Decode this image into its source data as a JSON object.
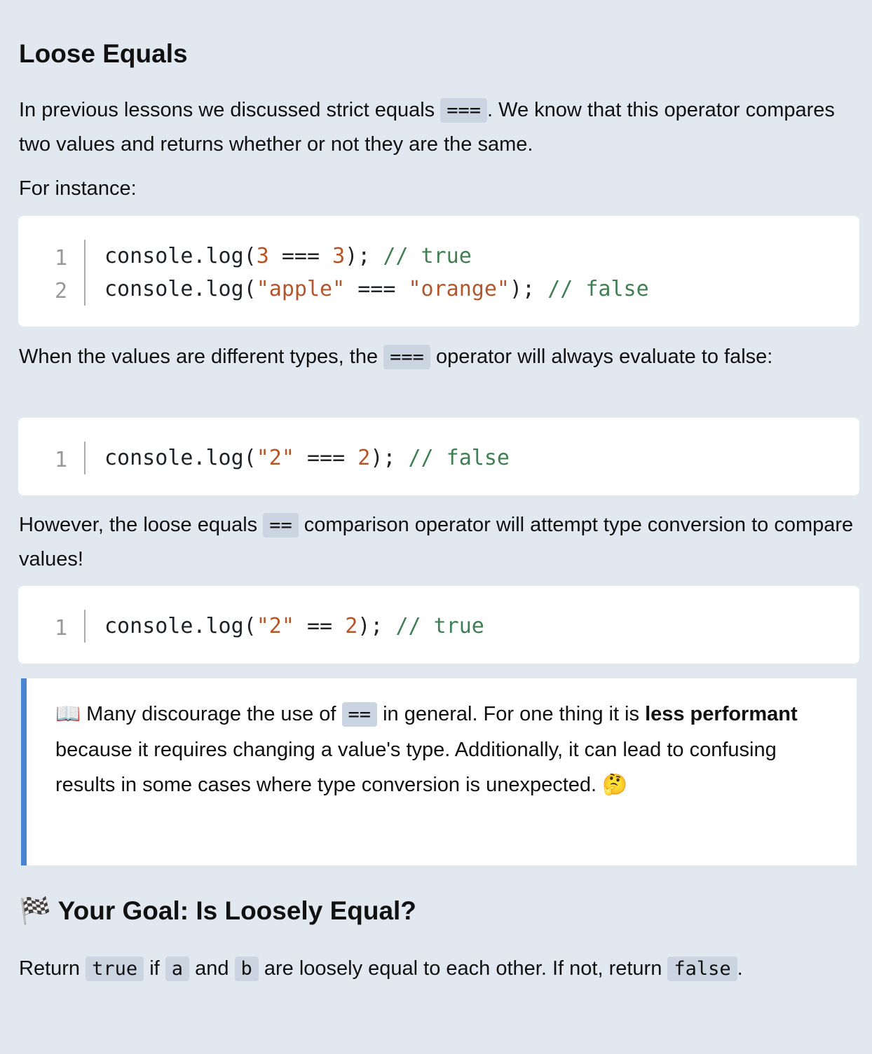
{
  "title": "Loose Equals",
  "para1": [
    {
      "text": "In previous lessons we discussed strict equals "
    },
    {
      "code": "==="
    },
    {
      "text": ". We know that this operator compares two values and returns whether or not they are the same."
    }
  ],
  "para2": [
    {
      "text": "For instance:"
    }
  ],
  "code1": [
    [
      {
        "t": "console.log(",
        "c": "plain"
      },
      {
        "t": "3",
        "c": "num"
      },
      {
        "t": " === ",
        "c": "plain"
      },
      {
        "t": "3",
        "c": "num"
      },
      {
        "t": "); ",
        "c": "plain"
      },
      {
        "t": "// true",
        "c": "com"
      }
    ],
    [
      {
        "t": "console.log(",
        "c": "plain"
      },
      {
        "t": "\"apple\"",
        "c": "str"
      },
      {
        "t": " === ",
        "c": "plain"
      },
      {
        "t": "\"orange\"",
        "c": "str"
      },
      {
        "t": "); ",
        "c": "plain"
      },
      {
        "t": "// false",
        "c": "com"
      }
    ]
  ],
  "para3": [
    {
      "text": "When the values are different types, the "
    },
    {
      "code": "==="
    },
    {
      "text": " operator will always evaluate to false:"
    }
  ],
  "code2": [
    [
      {
        "t": "console.log(",
        "c": "plain"
      },
      {
        "t": "\"2\"",
        "c": "str"
      },
      {
        "t": " === ",
        "c": "plain"
      },
      {
        "t": "2",
        "c": "num"
      },
      {
        "t": "); ",
        "c": "plain"
      },
      {
        "t": "// false",
        "c": "com"
      }
    ]
  ],
  "para4": [
    {
      "text": "However, the loose equals "
    },
    {
      "code": "=="
    },
    {
      "text": " comparison operator will attempt type conversion to compare values!"
    }
  ],
  "code3": [
    [
      {
        "t": "console.log(",
        "c": "plain"
      },
      {
        "t": "\"2\"",
        "c": "str"
      },
      {
        "t": " == ",
        "c": "plain"
      },
      {
        "t": "2",
        "c": "num"
      },
      {
        "t": "); ",
        "c": "plain"
      },
      {
        "t": "// true",
        "c": "com"
      }
    ]
  ],
  "callout": [
    {
      "text": "📖 Many discourage the use of "
    },
    {
      "code": "=="
    },
    {
      "text": " in general. For one thing it is "
    },
    {
      "bold": "less performant"
    },
    {
      "text": " because it requires changing a value's type. Additionally, it can lead to confusing results in some cases where type conversion is unexpected. 🤔"
    }
  ],
  "goal_heading": "🏁 Your Goal: Is Loosely Equal?",
  "goal": [
    {
      "text": "Return "
    },
    {
      "code": "true"
    },
    {
      "text": " if "
    },
    {
      "code": "a"
    },
    {
      "text": " and "
    },
    {
      "code": "b"
    },
    {
      "text": " are loosely equal to each other. If not, return "
    },
    {
      "code": "false"
    },
    {
      "text": "."
    }
  ],
  "colors": {
    "background": "#e2e8f0",
    "inline_code_bg": "#cbd5e1",
    "callout_border": "#4a86d0",
    "number_string": "#b5562a",
    "comment": "#3f7f52"
  }
}
